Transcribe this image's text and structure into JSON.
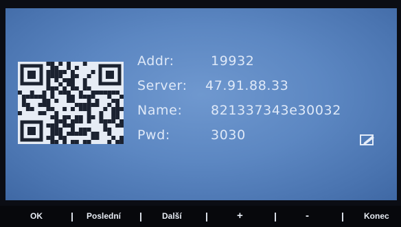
{
  "device": {
    "addr": {
      "label": "Addr:",
      "value": "19932"
    },
    "server": {
      "label": "Server:",
      "value": "47.91.88.33"
    },
    "name": {
      "label": "Name:",
      "value": "821337343e30032"
    },
    "pwd": {
      "label": "Pwd:",
      "value": "3030"
    }
  },
  "icons": {
    "qr": "qr-code-icon",
    "edit": "edit-icon"
  },
  "toolbar": {
    "ok": "OK",
    "posledni": "Poslední",
    "dalsi": "Další",
    "plus": "+",
    "minus": "-",
    "konec": "Konec"
  },
  "colors": {
    "screen": "#5c87c2",
    "text": "#dfe9f8",
    "toolbar": "#07080c"
  }
}
